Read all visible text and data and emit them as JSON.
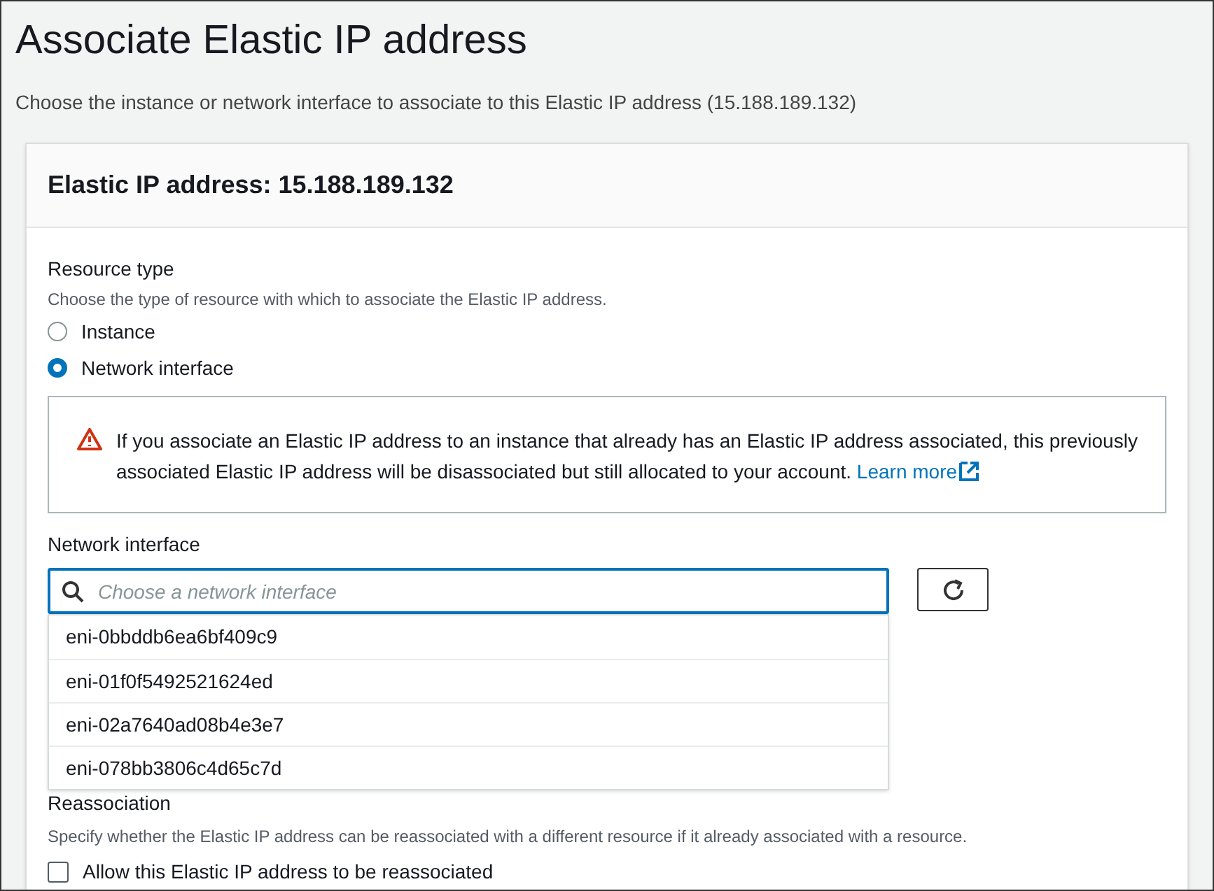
{
  "page": {
    "title": "Associate Elastic IP address",
    "description": "Choose the instance or network interface to associate to this Elastic IP address (15.188.189.132)"
  },
  "panel": {
    "header": "Elastic IP address: 15.188.189.132",
    "resource_type": {
      "label": "Resource type",
      "description": "Choose the type of resource with which to associate the Elastic IP address.",
      "options": [
        {
          "label": "Instance",
          "selected": false
        },
        {
          "label": "Network interface",
          "selected": true
        }
      ]
    },
    "warning": {
      "text": "If you associate an Elastic IP address to an instance that already has an Elastic IP address associated, this previously associated Elastic IP address will be disassociated but still allocated to your account.",
      "link": "Learn more"
    },
    "network_interface": {
      "label": "Network interface",
      "placeholder": "Choose a network interface",
      "options": [
        "eni-0bbddb6ea6bf409c9",
        "eni-01f0f5492521624ed",
        "eni-02a7640ad08b4e3e7",
        "eni-078bb3806c4d65c7d"
      ]
    },
    "reassociation": {
      "label": "Reassociation",
      "description": "Specify whether the Elastic IP address can be reassociated with a different resource if it already associated with a resource.",
      "checkbox": {
        "label": "Allow this Elastic IP address to be reassociated",
        "checked": false
      }
    }
  }
}
